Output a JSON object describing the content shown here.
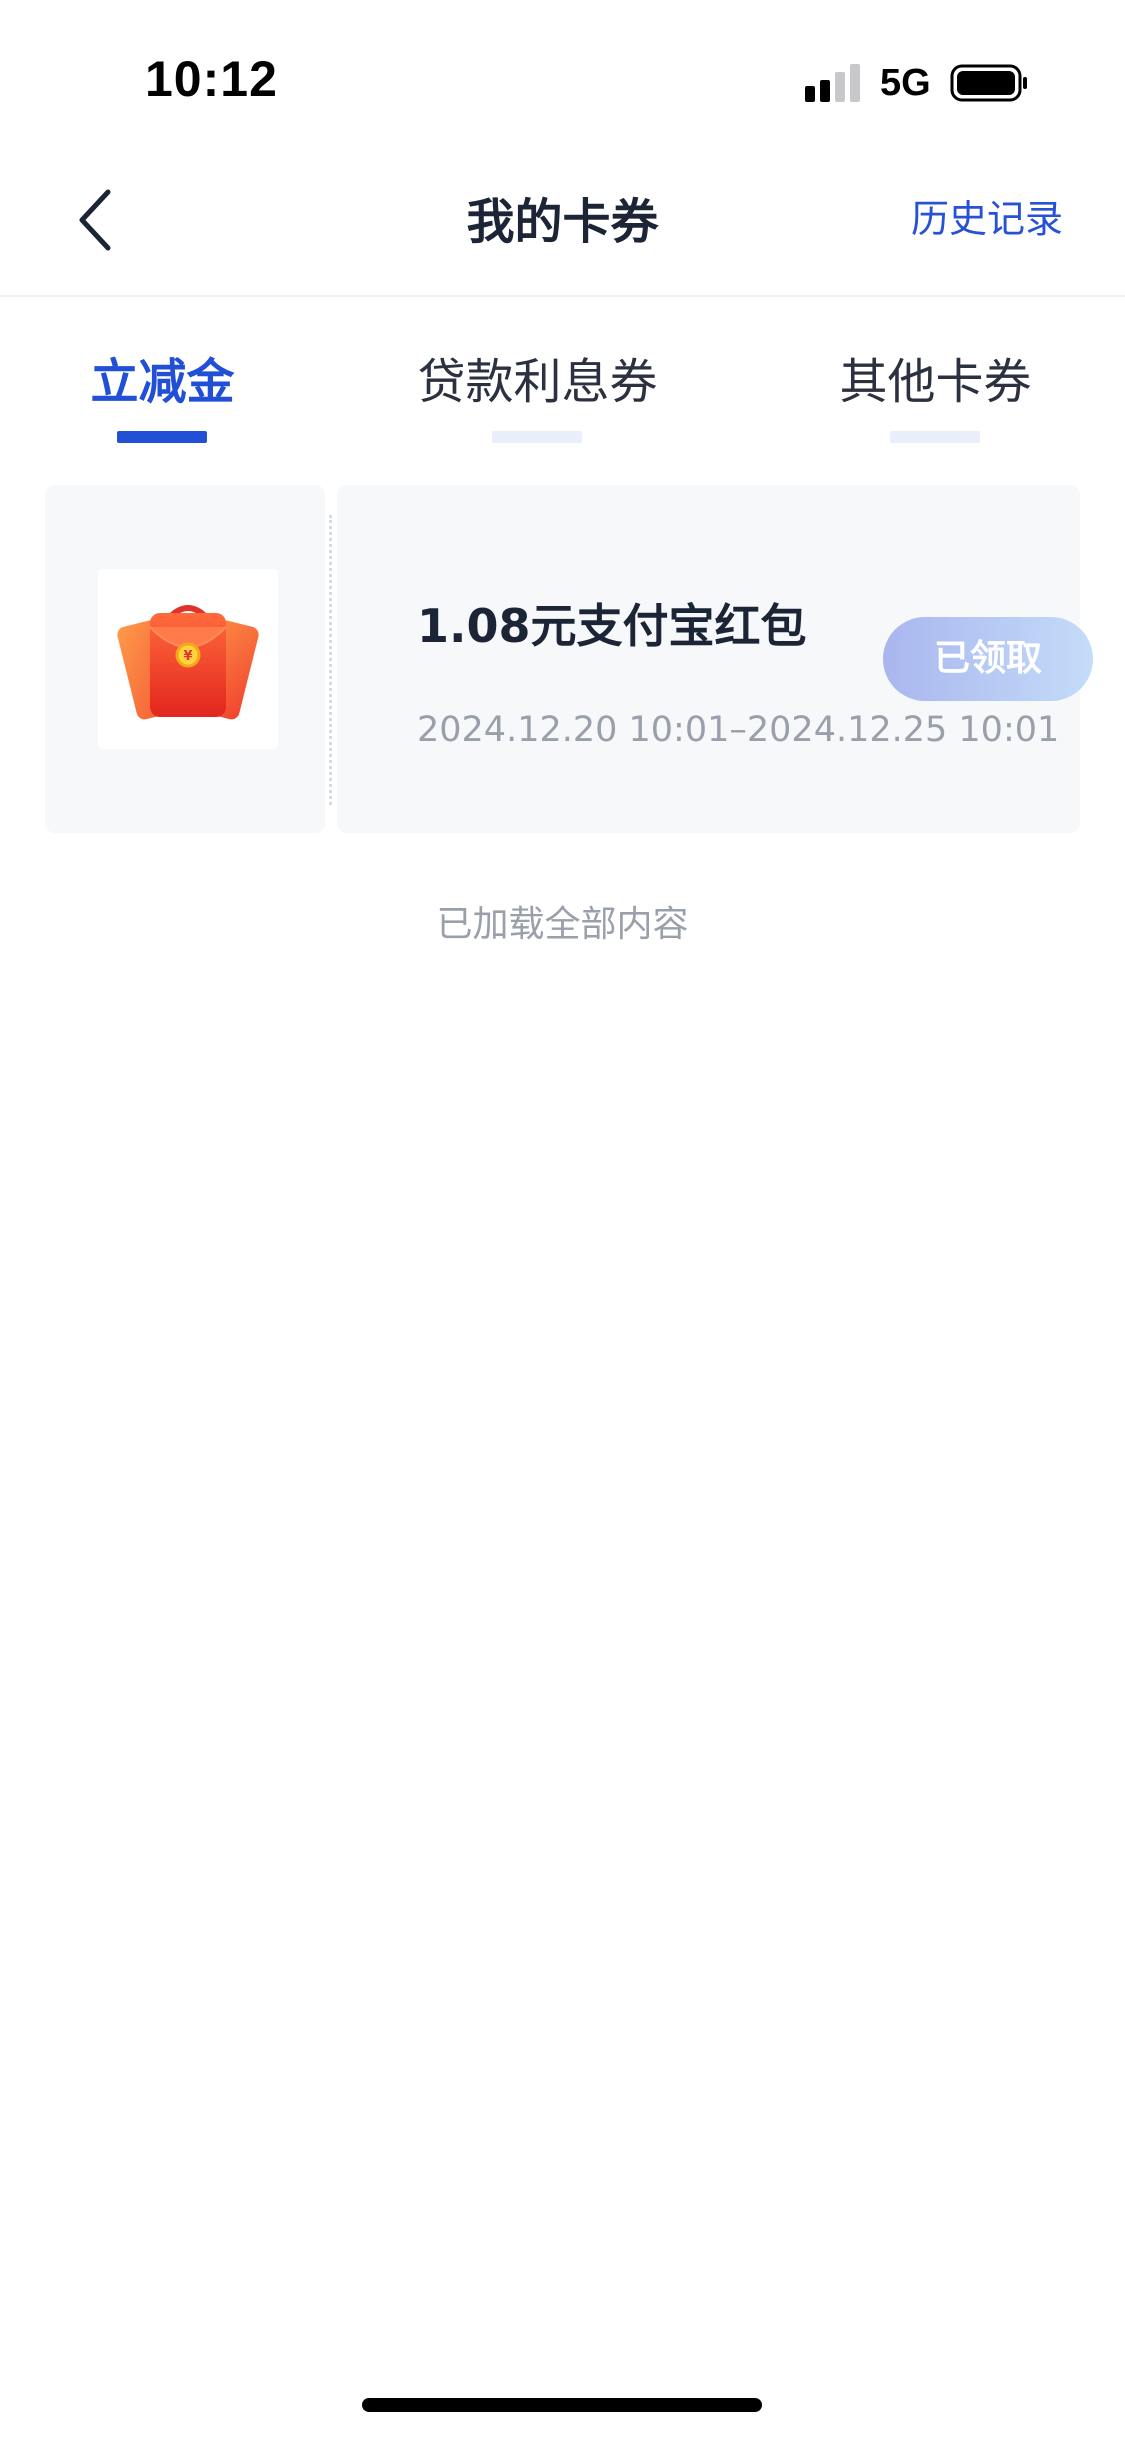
{
  "status_bar": {
    "time": "10:12",
    "network": "5G",
    "icons": [
      "signal-icon",
      "battery-icon"
    ]
  },
  "nav": {
    "title": "我的卡券",
    "right_link": "历史记录",
    "back_icon": "chevron-left-icon"
  },
  "tabs": [
    {
      "label": "立减金",
      "active": true
    },
    {
      "label": "贷款利息券",
      "active": false
    },
    {
      "label": "其他卡券",
      "active": false
    }
  ],
  "coupons": [
    {
      "title": "1.08元支付宝红包",
      "period": "2024.12.20 10:01–2024.12.25 10:01",
      "button": "已领取",
      "icon": "red-envelope-icon"
    }
  ],
  "footer": {
    "message": "已加载全部内容"
  },
  "colors": {
    "accent": "#2150d6",
    "link": "#2852d6",
    "card_bg": "#f6f8fa",
    "muted_text": "#9aa0ab",
    "button_gradient_start": "#a9b6ee",
    "button_gradient_end": "#c4dcf9"
  }
}
